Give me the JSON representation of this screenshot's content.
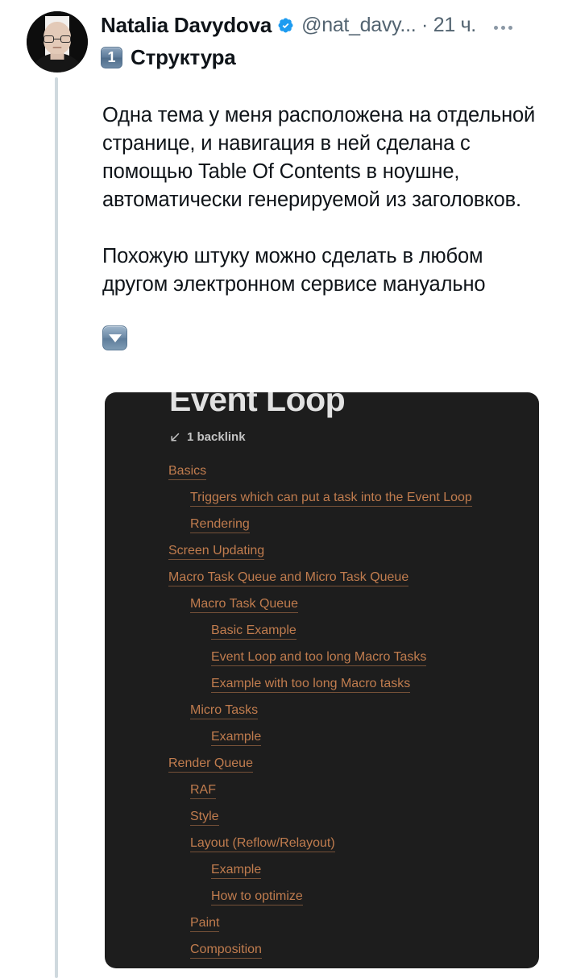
{
  "tweet": {
    "display_name": "Natalia Davydova",
    "verified": true,
    "handle": "@nat_davy...",
    "separator": "·",
    "timestamp": "21 ч.",
    "more_label": "",
    "keycap_number": "1",
    "title": "Структура",
    "paragraphs": [
      "Одна тема у меня расположена на отдельной странице, и навигация в ней сделана с помощью Table Of Contents в ноушне, автоматически генерируемой из заголовков.",
      "Похожую штуку можно сделать в любом другом электронном сервисе мануально"
    ]
  },
  "card": {
    "title": "Event Loop",
    "backlink_text": "1 backlink",
    "background_color": "#1d1d1d",
    "link_color": "#c07c4e",
    "title_color": "#e2e2e2",
    "toc": [
      {
        "label": "Basics",
        "level": 0
      },
      {
        "label": "Triggers which can put a task into the Event Loop",
        "level": 1
      },
      {
        "label": "Rendering",
        "level": 1
      },
      {
        "label": "Screen Updating",
        "level": 0
      },
      {
        "label": "Macro Task Queue and Micro Task Queue",
        "level": 0
      },
      {
        "label": "Macro Task Queue",
        "level": 1
      },
      {
        "label": "Basic Example",
        "level": 2
      },
      {
        "label": "Event Loop and too long Macro Tasks",
        "level": 2
      },
      {
        "label": "Example with too long Macro tasks",
        "level": 2
      },
      {
        "label": "Micro Tasks",
        "level": 1
      },
      {
        "label": "Example",
        "level": 2
      },
      {
        "label": "Render Queue",
        "level": 0
      },
      {
        "label": "RAF",
        "level": 1
      },
      {
        "label": "Style",
        "level": 1
      },
      {
        "label": "Layout (Reflow/Relayout)",
        "level": 1
      },
      {
        "label": "Example",
        "level": 2
      },
      {
        "label": "How to optimize",
        "level": 2
      },
      {
        "label": "Paint",
        "level": 1
      },
      {
        "label": "Composition",
        "level": 1
      }
    ]
  },
  "colors": {
    "text": "#0f1419",
    "muted": "#536471",
    "verified_blue": "#1d9bf0",
    "thread_line": "#cfd9de"
  }
}
